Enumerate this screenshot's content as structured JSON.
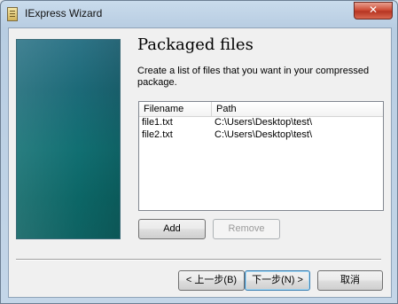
{
  "window": {
    "title": "IExpress Wizard",
    "close_glyph": "✕"
  },
  "page": {
    "heading": "Packaged files",
    "description": "Create a list of files that you want in your compressed package."
  },
  "file_list": {
    "columns": [
      "Filename",
      "Path"
    ],
    "rows": [
      {
        "filename": "file1.txt",
        "path": "C:\\Users\\Desktop\\test\\"
      },
      {
        "filename": "file2.txt",
        "path": "C:\\Users\\Desktop\\test\\"
      }
    ]
  },
  "buttons": {
    "add": "Add",
    "remove": "Remove",
    "back": "< 上一步(B)",
    "next": "下一步(N) >",
    "cancel": "取消"
  },
  "colors": {
    "side_panel": "#116f72",
    "close_button": "#cf4f3a"
  },
  "icons": {
    "app": "iexpress-app-icon",
    "close": "close-icon"
  }
}
